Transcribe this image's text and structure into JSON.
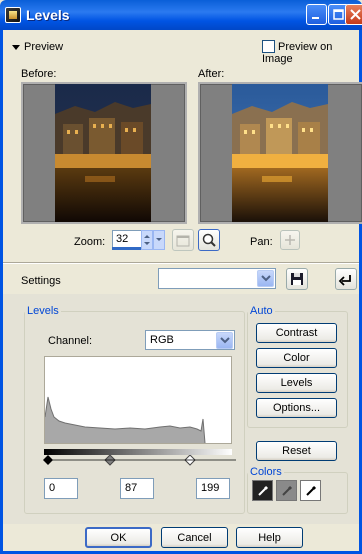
{
  "window": {
    "title": "Levels"
  },
  "preview": {
    "toggle_label": "Preview",
    "preview_on_image_label": "Preview on Image",
    "preview_on_image_checked": false,
    "before_label": "Before:",
    "after_label": "After:",
    "zoom_label": "Zoom:",
    "zoom_value": "32",
    "pan_label": "Pan:"
  },
  "settings": {
    "label": "Settings",
    "value": ""
  },
  "levels": {
    "group_label": "Levels",
    "channel_label": "Channel:",
    "channel_value": "RGB",
    "input_black": "0",
    "input_gamma": "87",
    "input_white": "199"
  },
  "auto": {
    "group_label": "Auto",
    "contrast": "Contrast",
    "color": "Color",
    "levels": "Levels",
    "options": "Options...",
    "reset": "Reset"
  },
  "colors": {
    "group_label": "Colors"
  },
  "footer": {
    "ok": "OK",
    "cancel": "Cancel",
    "help": "Help"
  }
}
